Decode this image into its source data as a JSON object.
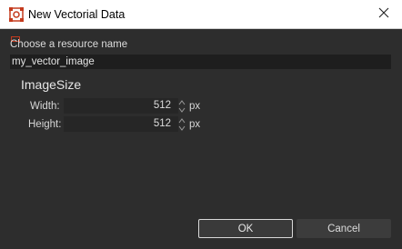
{
  "window": {
    "title": "New Vectorial Data",
    "app_icon": "app-logo-icon",
    "close_icon": "close-icon"
  },
  "form": {
    "resource_label": "Choose a resource name",
    "resource_value": "my_vector_image"
  },
  "image_size": {
    "title": "ImageSize",
    "width_label": "Width:",
    "width_value": "512",
    "width_unit": "px",
    "height_label": "Height:",
    "height_value": "512",
    "height_unit": "px"
  },
  "buttons": {
    "ok_label": "OK",
    "cancel_label": "Cancel"
  },
  "colors": {
    "background": "#2d2d2d",
    "titlebar": "#ffffff",
    "input_bg": "#1e1e1e",
    "accent": "#c43b1e"
  }
}
